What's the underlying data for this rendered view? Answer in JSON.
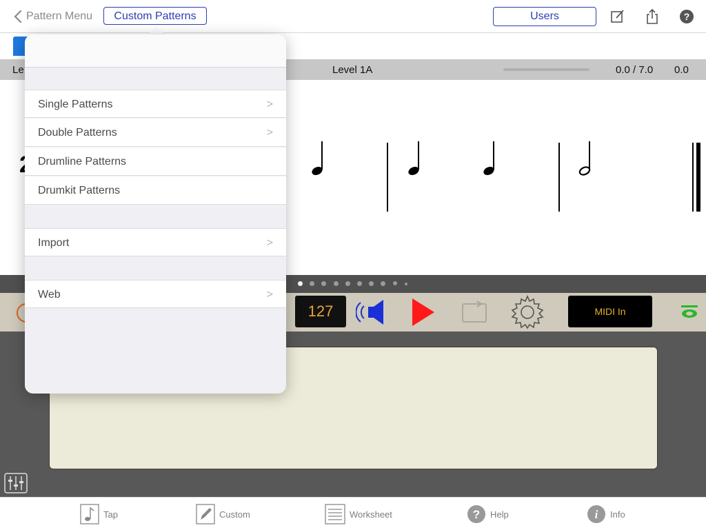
{
  "nav": {
    "back_label": "Pattern Menu",
    "title_button": "Custom Patterns",
    "users_button": "Users",
    "icons": [
      "compose-icon",
      "share-icon",
      "help-icon"
    ]
  },
  "level_bar": {
    "left_label": "Le",
    "level_name": "Level 1A",
    "ratio": "0.0 / 7.0",
    "value": "0.0"
  },
  "staff": {
    "time_signature_partial": "2"
  },
  "controls": {
    "velocity": "127",
    "midi_button": "MIDI In",
    "page_dots": 10,
    "active_dot": 0
  },
  "popover": {
    "sections": [
      {
        "items": [
          {
            "label": "Single Patterns",
            "chevron": true
          },
          {
            "label": "Double Patterns",
            "chevron": true
          },
          {
            "label": "Drumline Patterns",
            "chevron": false
          },
          {
            "label": "Drumkit Patterns",
            "chevron": false
          }
        ]
      },
      {
        "items": [
          {
            "label": "Import",
            "chevron": true
          }
        ]
      },
      {
        "items": [
          {
            "label": "Web",
            "chevron": true
          }
        ]
      }
    ],
    "chevron_glyph": ">"
  },
  "tabbar": {
    "tap": "Tap",
    "custom": "Custom",
    "worksheet": "Worksheet",
    "help": "Help",
    "info": "Info"
  },
  "colors": {
    "accent": "#2c3fb0",
    "play": "#ff1a1a",
    "speaker": "#1a2fd6",
    "midi_text": "#e0b02a"
  }
}
